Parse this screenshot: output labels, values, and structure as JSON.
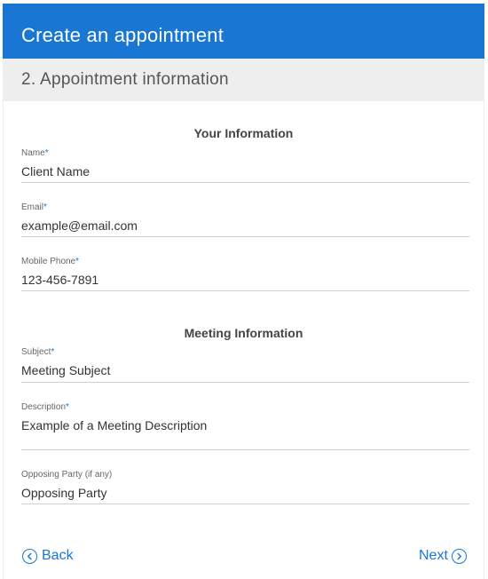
{
  "header": {
    "title": "Create an appointment"
  },
  "step": {
    "title": "2. Appointment information"
  },
  "sections": {
    "your_info": "Your Information",
    "meeting_info": "Meeting Information"
  },
  "fields": {
    "name": {
      "label": "Name",
      "required_mark": "*",
      "value": "Client Name"
    },
    "email": {
      "label": "Email",
      "required_mark": "*",
      "value": "example@email.com"
    },
    "mobile": {
      "label": "Mobile Phone",
      "required_mark": "*",
      "value": "123-456-7891"
    },
    "subject": {
      "label": "Subject",
      "required_mark": "*",
      "value": "Meeting Subject"
    },
    "description": {
      "label": "Description",
      "required_mark": "*",
      "value": "Example of a Meeting Description"
    },
    "opposing": {
      "label": "Opposing Party (if any)",
      "value": "Opposing Party"
    }
  },
  "nav": {
    "back_label": "Back",
    "next_label": "Next"
  },
  "colors": {
    "accent": "#1976d2",
    "step_bar": "#eeeeee"
  },
  "icons": {
    "back": "chevron-left-circle-icon",
    "next": "chevron-right-circle-icon"
  }
}
